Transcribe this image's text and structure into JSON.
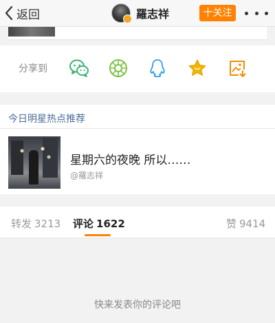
{
  "navbar": {
    "back_label": "返回",
    "profile_name": "羅志祥",
    "follow_label": "十关注"
  },
  "share": {
    "label": "分享到",
    "targets": [
      "wechat",
      "moments",
      "qq",
      "favorites",
      "save"
    ]
  },
  "hot": {
    "title": "今日明星热点推荐",
    "post_text": "星期六的夜晚 所以……",
    "post_author": "@羅志祥"
  },
  "tabs": [
    {
      "label": "转发",
      "count": "3213",
      "active": false
    },
    {
      "label": "评论",
      "count": "1622",
      "active": true
    },
    {
      "label": "赞",
      "count": "9414",
      "active": false
    }
  ],
  "comments": {
    "empty_hint": "快来发表你的评论吧"
  },
  "colors": {
    "accent": "#ff8200",
    "link_blue": "#4a6d99",
    "wechat_green": "#3cb371",
    "moments_green": "#7cc142",
    "qq_blue": "#2a9ee3",
    "favorite_gold": "#f4b400"
  }
}
